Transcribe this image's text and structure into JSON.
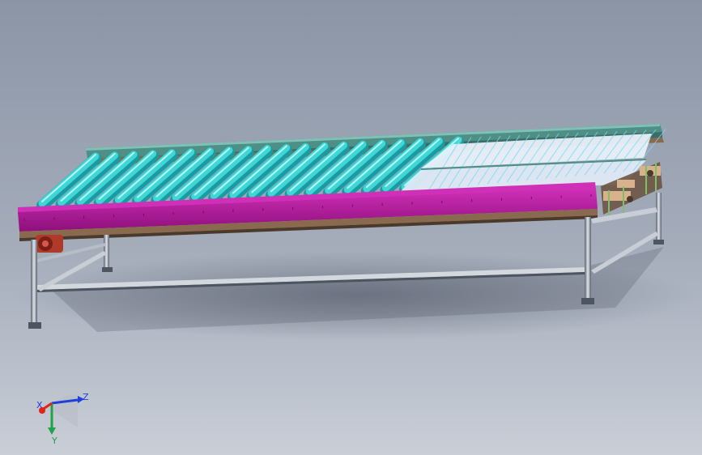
{
  "viewport": {
    "background_top": "#8b95a6",
    "background_bottom": "#c9ced7"
  },
  "colors": {
    "roller": "#3fd6d6",
    "roller_highlight": "#b8f7f7",
    "roller_shadow": "#1a9aa3",
    "side_rail": "#b5179e",
    "side_rail_top": "#d030b8",
    "back_rail": "#4f8f86",
    "frame_brown": "#8a6a4e",
    "frame_dark": "#4b3a2c",
    "leg_steel": "#c9ced6",
    "leg_dark": "#4d5560",
    "glass": "#e8f0fa",
    "glass_line": "#7fd7ee",
    "motor": "#b03a2a",
    "bracket": "#d8b28a"
  },
  "roller_count": 20,
  "axes": {
    "x_label": "X",
    "y_label": "Y",
    "z_label": "Z",
    "x_color": "#e2231a",
    "y_color": "#1fa24a",
    "z_color": "#1f3fd6"
  }
}
